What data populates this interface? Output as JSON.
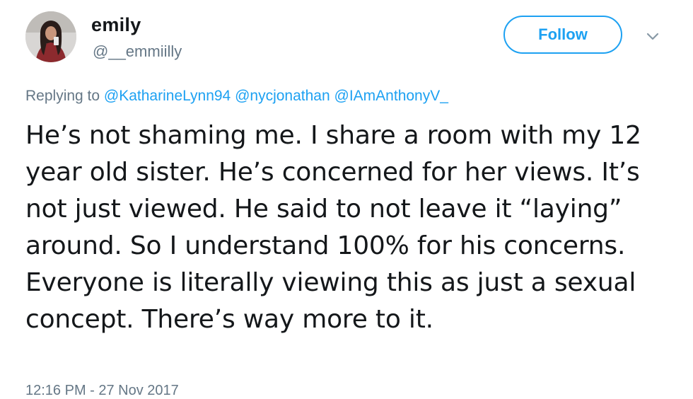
{
  "user": {
    "display_name": "emily",
    "handle": "@__emmiilly",
    "avatar_icon": "profile-photo"
  },
  "actions": {
    "follow_label": "Follow",
    "menu_icon": "chevron-down-icon",
    "accent_color": "#1da1f2"
  },
  "reply": {
    "prefix": "Replying to",
    "mentions": [
      "@KatharineLynn94",
      "@nycjonathan",
      "@IAmAnthonyV_"
    ]
  },
  "tweet": {
    "text": "He’s not shaming me. I share a room with my 12 year old sister. He’s concerned for her views. It’s not just viewed. He said to not leave it “laying” around. So I understand 100% for his concerns. Everyone is literally viewing this as just a sexual concept. There’s way more to it.",
    "timestamp": "12:16 PM - 27 Nov 2017"
  }
}
